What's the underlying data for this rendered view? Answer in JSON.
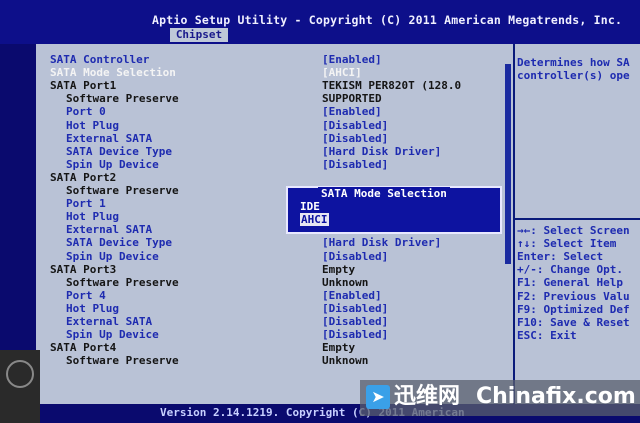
{
  "header": {
    "title": "Aptio Setup Utility - Copyright (C) 2011 American Megatrends, Inc.",
    "active_tab": "Chipset"
  },
  "settings": [
    {
      "label": "SATA Controller",
      "value": "[Enabled]",
      "indent": false,
      "label_color": "blue",
      "value_color": "blue"
    },
    {
      "label": "SATA Mode Selection",
      "value": "[AHCI]",
      "indent": false,
      "label_color": "white",
      "value_color": "white"
    },
    {
      "label": "SATA Port1",
      "value": "TEKISM PER820T (128.0",
      "indent": false,
      "label_color": "black",
      "value_color": "black"
    },
    {
      "label": "Software Preserve",
      "value": "SUPPORTED",
      "indent": true,
      "label_color": "black",
      "value_color": "black"
    },
    {
      "label": "Port 0",
      "value": "[Enabled]",
      "indent": true,
      "label_color": "blue",
      "value_color": "blue"
    },
    {
      "label": "Hot Plug",
      "value": "[Disabled]",
      "indent": true,
      "label_color": "blue",
      "value_color": "blue"
    },
    {
      "label": "External SATA",
      "value": "[Disabled]",
      "indent": true,
      "label_color": "blue",
      "value_color": "blue"
    },
    {
      "label": "SATA Device Type",
      "value": "[Hard Disk Driver]",
      "indent": true,
      "label_color": "blue",
      "value_color": "blue"
    },
    {
      "label": "Spin Up Device",
      "value": "[Disabled]",
      "indent": true,
      "label_color": "blue",
      "value_color": "blue"
    },
    {
      "label": "SATA Port2",
      "value": "",
      "indent": false,
      "label_color": "black",
      "value_color": "black"
    },
    {
      "label": "Software Preserve",
      "value": "",
      "indent": true,
      "label_color": "black",
      "value_color": "black"
    },
    {
      "label": "Port 1",
      "value": "",
      "indent": true,
      "label_color": "blue",
      "value_color": "blue"
    },
    {
      "label": "Hot Plug",
      "value": "",
      "indent": true,
      "label_color": "blue",
      "value_color": "blue"
    },
    {
      "label": "External SATA",
      "value": "",
      "indent": true,
      "label_color": "blue",
      "value_color": "blue"
    },
    {
      "label": "SATA Device Type",
      "value": "[Hard Disk Driver]",
      "indent": true,
      "label_color": "blue",
      "value_color": "blue"
    },
    {
      "label": "Spin Up Device",
      "value": "[Disabled]",
      "indent": true,
      "label_color": "blue",
      "value_color": "blue"
    },
    {
      "label": "SATA Port3",
      "value": "Empty",
      "indent": false,
      "label_color": "black",
      "value_color": "black"
    },
    {
      "label": "Software Preserve",
      "value": "Unknown",
      "indent": true,
      "label_color": "black",
      "value_color": "black"
    },
    {
      "label": "Port 4",
      "value": "[Enabled]",
      "indent": true,
      "label_color": "blue",
      "value_color": "blue"
    },
    {
      "label": "Hot Plug",
      "value": "[Disabled]",
      "indent": true,
      "label_color": "blue",
      "value_color": "blue"
    },
    {
      "label": "External SATA",
      "value": "[Disabled]",
      "indent": true,
      "label_color": "blue",
      "value_color": "blue"
    },
    {
      "label": "Spin Up Device",
      "value": "[Disabled]",
      "indent": true,
      "label_color": "blue",
      "value_color": "blue"
    },
    {
      "label": "SATA Port4",
      "value": "Empty",
      "indent": false,
      "label_color": "black",
      "value_color": "black"
    },
    {
      "label": "Software Preserve",
      "value": "Unknown",
      "indent": true,
      "label_color": "black",
      "value_color": "black"
    }
  ],
  "help_text": [
    "Determines how SA",
    "controller(s) ope"
  ],
  "key_help": [
    "→←: Select Screen",
    "↑↓: Select Item",
    "Enter: Select",
    "+/-: Change Opt.",
    "F1: General Help",
    "F2: Previous Valu",
    "F9: Optimized Def",
    "F10: Save & Reset",
    "ESC: Exit"
  ],
  "popup": {
    "title": "SATA Mode Selection",
    "options": [
      {
        "label": "IDE",
        "selected": false
      },
      {
        "label": "AHCI",
        "selected": true
      }
    ]
  },
  "footer": {
    "version": "Version 2.14.1219. Copyright (C) 2011 American"
  },
  "watermark": {
    "left": "迅维网",
    "right": "Chinafix.com"
  },
  "colors": {
    "background": "#0a0a6e",
    "panel": "#b9c2d6",
    "option_blue": "#1e2bb0",
    "popup_bg": "#0d13a0"
  }
}
